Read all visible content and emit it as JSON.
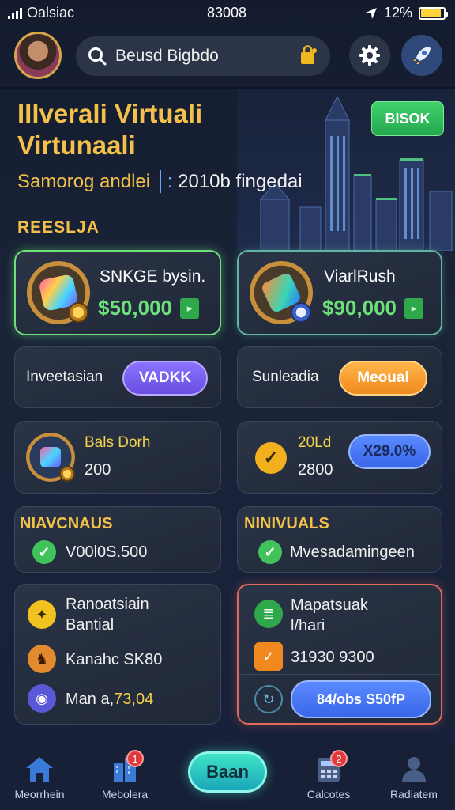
{
  "status_bar": {
    "carrier": "Oalsiac",
    "time": "83008",
    "battery": "12%",
    "battery_level": 0.9
  },
  "header": {
    "search_value": "Beusd Bigbdo"
  },
  "hero": {
    "title": "IIlverali Virtuali Virtunaali",
    "subtitle_label": "Samorog andlei",
    "subtitle_sep": "│:",
    "subtitle_value": "2010b fingedai",
    "button": "BISOK"
  },
  "section_label": "REESLJA",
  "featured": [
    {
      "title": "SNKGE bysin.",
      "price": "$50,000",
      "tag": "▸"
    },
    {
      "title": "ViarlRush",
      "price": "$90,000",
      "tag": "▸"
    }
  ],
  "actions": [
    {
      "label": "Inveetasian",
      "button": "VADKK"
    },
    {
      "label": "Sunleadia",
      "button": "Meoual"
    }
  ],
  "stats": [
    {
      "title": "Bals Dorh",
      "value": "200"
    },
    {
      "title": "20Ld",
      "value": "2800",
      "button": "X29.0%"
    }
  ],
  "lists": [
    {
      "heading": "NIAVCNAUS",
      "text": "V00l0S.500"
    },
    {
      "heading": "NINIVUALS",
      "text": "Mvesadamingeen"
    }
  ],
  "panel_left": {
    "title_line1": "Ranoatsiain",
    "title_line2": "Bantial",
    "row1": "Kanahc SK80",
    "row2_prefix": "Man a,",
    "row2_value": "73,04"
  },
  "panel_right": {
    "title_line1": "Mapatsuak",
    "title_line2": "l/hari",
    "row1": "31930 9300",
    "button": "84/obs S50fP"
  },
  "nav": {
    "items": [
      {
        "label": "Meorrhein"
      },
      {
        "label": "Mebolera",
        "badge": "1"
      },
      {
        "label": "Calcotes",
        "badge": "2"
      },
      {
        "label": "Radiatem"
      }
    ],
    "center_button": "Baan"
  }
}
